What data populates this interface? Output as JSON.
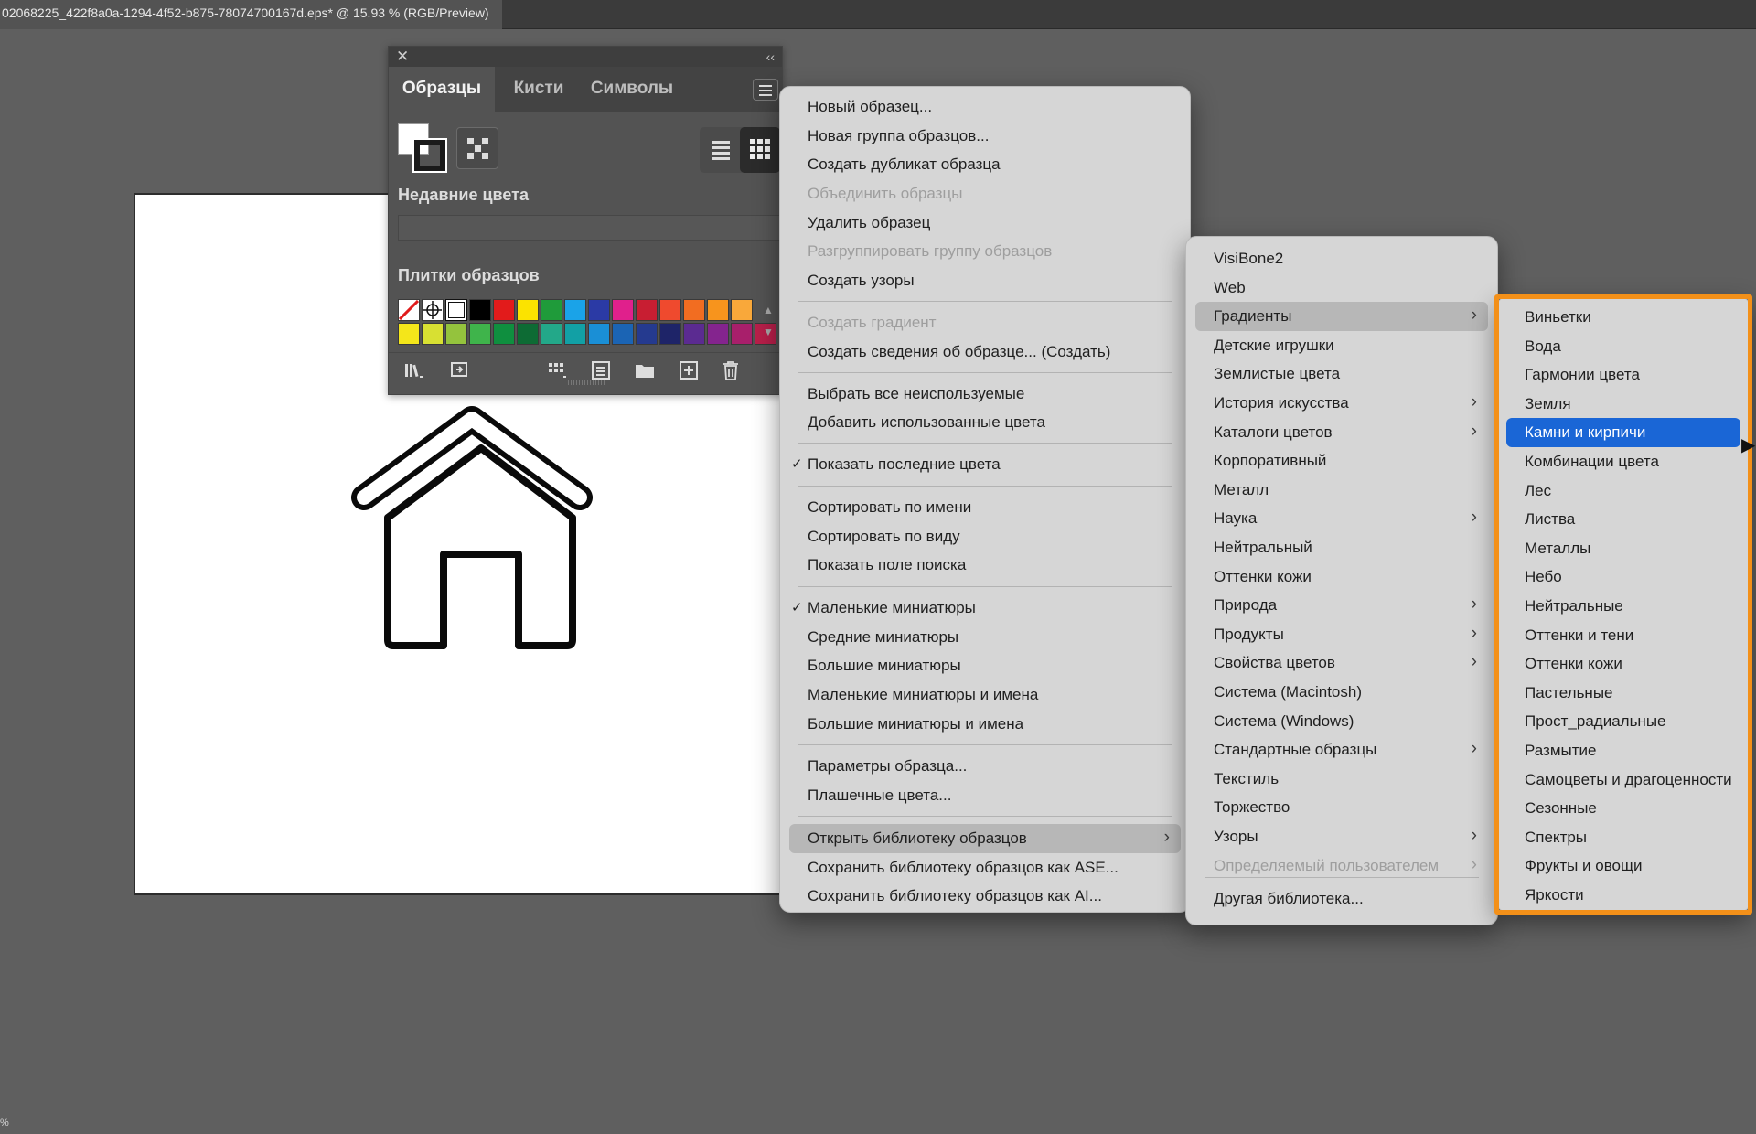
{
  "window": {
    "doc_tab": "02068225_422f8a0a-1294-4f52-b875-78074700167d.eps* @ 15.93 % (RGB/Preview)"
  },
  "panel": {
    "close": "✕",
    "collapse": "‹‹",
    "tabs": [
      "Образцы",
      "Кисти",
      "Символы"
    ],
    "recent_colors_label": "Недавние цвета",
    "swatch_tiles_label": "Плитки образцов",
    "swatch_colors": [
      "#000000",
      "#e21b1b",
      "#fbe300",
      "#1f9b3a",
      "#1aa3e8",
      "#2b3aa5",
      "#e0208c",
      "#c81e32",
      "#ef4a2e",
      "#f26d21",
      "#f7941d",
      "#f9a83a",
      "#f4e61a",
      "#d8e032",
      "#94c33d",
      "#3fb44b",
      "#0f8f3f",
      "#0d6b34",
      "#23a889",
      "#12a0a5",
      "#1a8fd6",
      "#1b64b4",
      "#253a8f",
      "#1e2468",
      "#5b2b91",
      "#84248e",
      "#a81f6b",
      "#b81f4a"
    ],
    "bottom_icons": [
      "libraries-menu-icon",
      "place-swatch-icon",
      "kind-menu-icon",
      "swatch-options-icon",
      "new-group-icon",
      "new-swatch-icon",
      "delete-icon"
    ]
  },
  "menu_main": {
    "items": [
      {
        "label": "Новый образец...",
        "disabled": false
      },
      {
        "label": "Новая группа образцов...",
        "disabled": false
      },
      {
        "label": "Создать дубликат образца",
        "disabled": false
      },
      {
        "label": "Объединить образцы",
        "disabled": true
      },
      {
        "label": "Удалить образец",
        "disabled": false
      },
      {
        "label": "Разгруппировать группу образцов",
        "disabled": true
      },
      {
        "label": "Создать узоры",
        "disabled": false
      },
      {
        "label": "Создать градиент",
        "disabled": true
      },
      {
        "label": "Создать сведения об образце... (Создать)",
        "disabled": false
      },
      {
        "label": "Выбрать все неиспользуемые",
        "disabled": false
      },
      {
        "label": "Добавить использованные цвета",
        "disabled": false
      },
      {
        "label": "Показать последние цвета",
        "checked": true
      },
      {
        "label": "Сортировать по имени",
        "disabled": false
      },
      {
        "label": "Сортировать по виду",
        "disabled": false
      },
      {
        "label": "Показать поле поиска",
        "disabled": false
      },
      {
        "label": "Маленькие миниатюры",
        "checked": true
      },
      {
        "label": "Средние миниатюры",
        "disabled": false
      },
      {
        "label": "Большие миниатюры",
        "disabled": false
      },
      {
        "label": "Маленькие миниатюры и имена",
        "disabled": false
      },
      {
        "label": "Большие миниатюры и имена",
        "disabled": false
      },
      {
        "label": "Параметры образца...",
        "disabled": false
      },
      {
        "label": "Плашечные цвета...",
        "disabled": false
      },
      {
        "label": "Открыть библиотеку образцов",
        "submenu": true,
        "hovered": true
      },
      {
        "label": "Сохранить библиотеку образцов как ASE...",
        "disabled": false
      },
      {
        "label": "Сохранить библиотеку образцов как AI...",
        "disabled": false
      }
    ],
    "check_glyph": "✓",
    "arrow_glyph": "›"
  },
  "menu_library": {
    "items": [
      {
        "label": "VisiBone2"
      },
      {
        "label": "Web"
      },
      {
        "label": "Градиенты",
        "submenu": true,
        "hovered": true
      },
      {
        "label": "Детские игрушки"
      },
      {
        "label": "Землистые цвета"
      },
      {
        "label": "История искусства",
        "submenu": true
      },
      {
        "label": "Каталоги цветов",
        "submenu": true
      },
      {
        "label": "Корпоративный"
      },
      {
        "label": "Металл"
      },
      {
        "label": "Наука",
        "submenu": true
      },
      {
        "label": "Нейтральный"
      },
      {
        "label": "Оттенки кожи"
      },
      {
        "label": "Природа",
        "submenu": true
      },
      {
        "label": "Продукты",
        "submenu": true
      },
      {
        "label": "Свойства цветов",
        "submenu": true
      },
      {
        "label": "Система (Macintosh)"
      },
      {
        "label": "Система (Windows)"
      },
      {
        "label": "Стандартные образцы",
        "submenu": true
      },
      {
        "label": "Текстиль"
      },
      {
        "label": "Торжество"
      },
      {
        "label": "Узоры",
        "submenu": true
      },
      {
        "label": "Определяемый пользователем",
        "submenu": true,
        "disabled": true
      },
      {
        "label": "Другая библиотека..."
      }
    ]
  },
  "menu_gradients": {
    "items": [
      {
        "label": "Виньетки"
      },
      {
        "label": "Вода"
      },
      {
        "label": "Гармонии цвета"
      },
      {
        "label": "Земля"
      },
      {
        "label": "Камни и кирпичи",
        "selected": true
      },
      {
        "label": "Комбинации цвета"
      },
      {
        "label": "Лес"
      },
      {
        "label": "Листва"
      },
      {
        "label": "Металлы"
      },
      {
        "label": "Небо"
      },
      {
        "label": "Нейтральные"
      },
      {
        "label": "Оттенки и тени"
      },
      {
        "label": "Оттенки кожи"
      },
      {
        "label": "Пастельные"
      },
      {
        "label": "Прост_радиальные"
      },
      {
        "label": "Размытие"
      },
      {
        "label": "Самоцветы и драгоценности"
      },
      {
        "label": "Сезонные"
      },
      {
        "label": "Спектры"
      },
      {
        "label": "Фрукты и овощи"
      },
      {
        "label": "Яркости"
      }
    ]
  },
  "colors": {
    "highlight": "#f39019",
    "selection": "#1a66d6"
  },
  "corner_glyph": "%"
}
